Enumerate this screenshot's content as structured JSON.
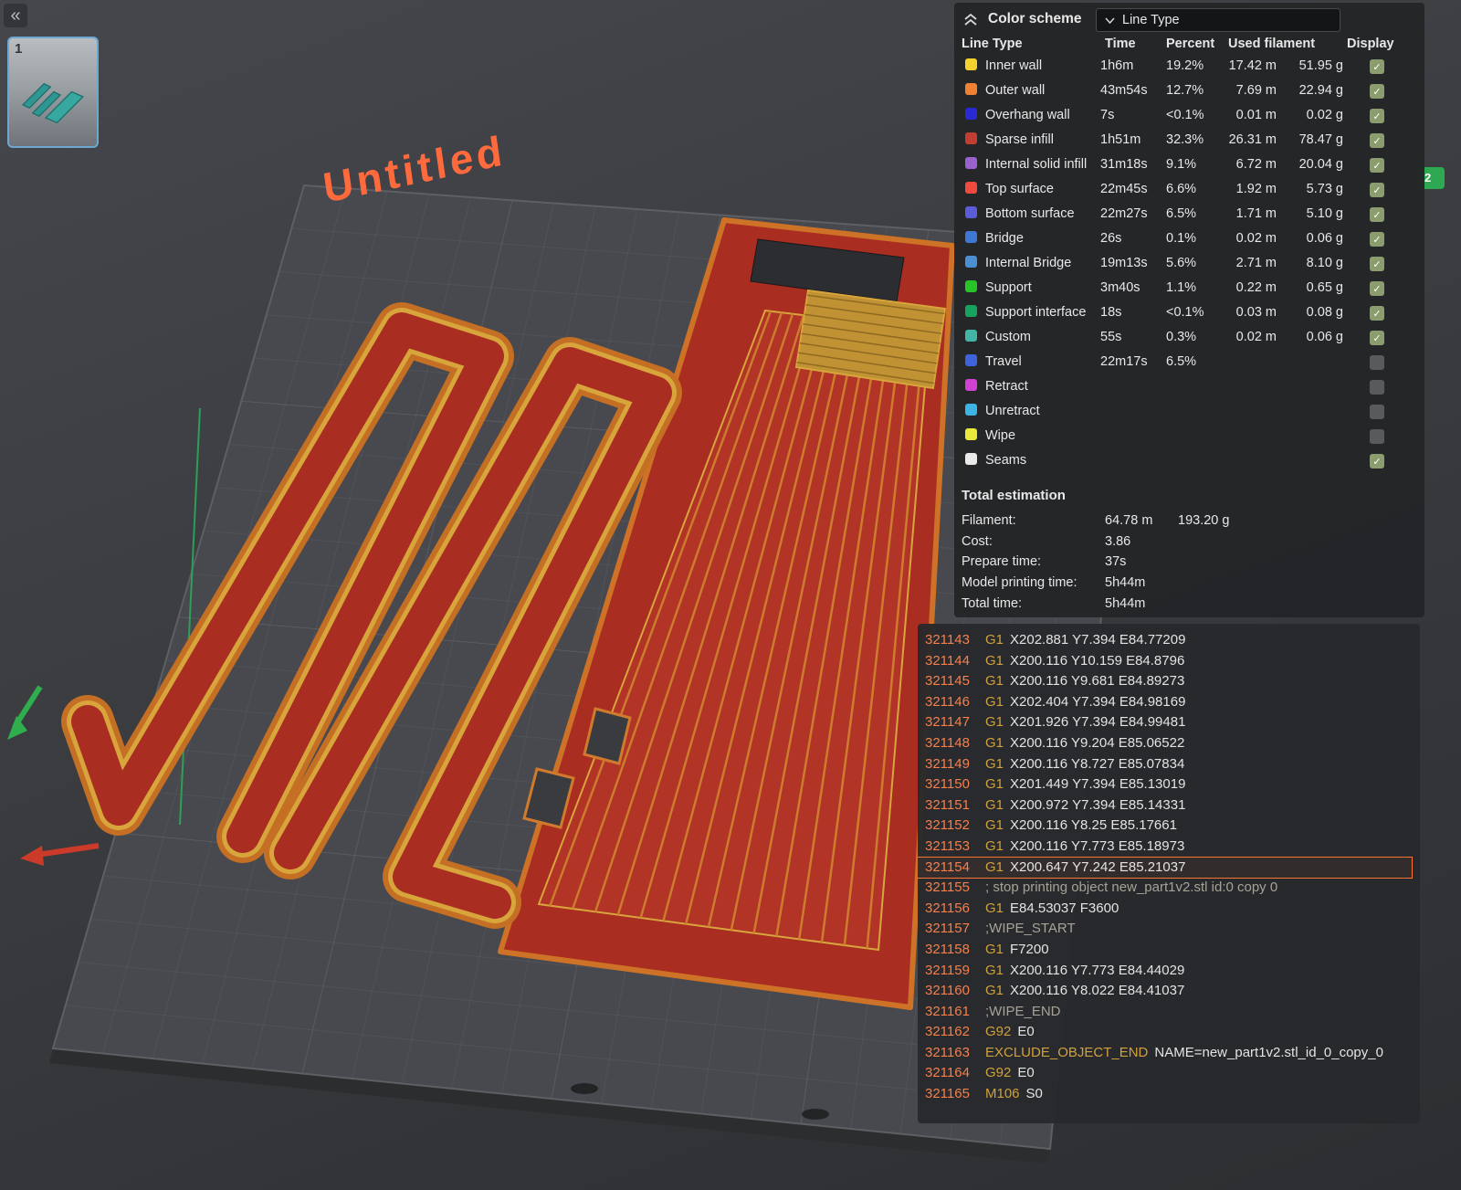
{
  "viewport": {
    "plate_label": "Untitled",
    "thumbnail_label": "1",
    "edge_badge": "2"
  },
  "icons": {
    "collapse_sidebar": "«",
    "check": "✓"
  },
  "color_scheme_panel": {
    "title": "Color scheme",
    "dropdown_value": "Line Type",
    "columns": [
      "Line Type",
      "Time",
      "Percent",
      "Used filament",
      "Display"
    ],
    "rows": [
      {
        "name": "Inner wall",
        "color": "#f6d32c",
        "time": "1h6m",
        "percent": "19.2%",
        "used_m": "17.42 m",
        "used_g": "51.95 g",
        "checked": true
      },
      {
        "name": "Outer wall",
        "color": "#f08132",
        "time": "43m54s",
        "percent": "12.7%",
        "used_m": "7.69 m",
        "used_g": "22.94 g",
        "checked": true
      },
      {
        "name": "Overhang wall",
        "color": "#2a2ad4",
        "time": "7s",
        "percent": "<0.1%",
        "used_m": "0.01 m",
        "used_g": "0.02 g",
        "checked": true
      },
      {
        "name": "Sparse infill",
        "color": "#c03e34",
        "time": "1h51m",
        "percent": "32.3%",
        "used_m": "26.31 m",
        "used_g": "78.47 g",
        "checked": true
      },
      {
        "name": "Internal solid infill",
        "color": "#9a62cc",
        "time": "31m18s",
        "percent": "9.1%",
        "used_m": "6.72 m",
        "used_g": "20.04 g",
        "checked": true
      },
      {
        "name": "Top surface",
        "color": "#f04a3e",
        "time": "22m45s",
        "percent": "6.6%",
        "used_m": "1.92 m",
        "used_g": "5.73 g",
        "checked": true
      },
      {
        "name": "Bottom surface",
        "color": "#5b5cd8",
        "time": "22m27s",
        "percent": "6.5%",
        "used_m": "1.71 m",
        "used_g": "5.10 g",
        "checked": true
      },
      {
        "name": "Bridge",
        "color": "#3f77d4",
        "time": "26s",
        "percent": "0.1%",
        "used_m": "0.02 m",
        "used_g": "0.06 g",
        "checked": true
      },
      {
        "name": "Internal Bridge",
        "color": "#4b8fd2",
        "time": "19m13s",
        "percent": "5.6%",
        "used_m": "2.71 m",
        "used_g": "8.10 g",
        "checked": true
      },
      {
        "name": "Support",
        "color": "#27c327",
        "time": "3m40s",
        "percent": "1.1%",
        "used_m": "0.22 m",
        "used_g": "0.65 g",
        "checked": true
      },
      {
        "name": "Support interface",
        "color": "#17a35f",
        "time": "18s",
        "percent": "<0.1%",
        "used_m": "0.03 m",
        "used_g": "0.08 g",
        "checked": true
      },
      {
        "name": "Custom",
        "color": "#43b5a6",
        "time": "55s",
        "percent": "0.3%",
        "used_m": "0.02 m",
        "used_g": "0.06 g",
        "checked": true
      },
      {
        "name": "Travel",
        "color": "#3e63dd",
        "time": "22m17s",
        "percent": "6.5%",
        "used_m": "",
        "used_g": "",
        "checked": false
      },
      {
        "name": "Retract",
        "color": "#d242d2",
        "time": "",
        "percent": "",
        "used_m": "",
        "used_g": "",
        "checked": false
      },
      {
        "name": "Unretract",
        "color": "#3eb4e4",
        "time": "",
        "percent": "",
        "used_m": "",
        "used_g": "",
        "checked": false
      },
      {
        "name": "Wipe",
        "color": "#e9e93c",
        "time": "",
        "percent": "",
        "used_m": "",
        "used_g": "",
        "checked": false
      },
      {
        "name": "Seams",
        "color": "#eaeaea",
        "time": "",
        "percent": "",
        "used_m": "",
        "used_g": "",
        "checked": true
      }
    ],
    "total_estimation": {
      "title": "Total estimation",
      "rows": [
        {
          "label": "Filament:",
          "v1": "64.78 m",
          "v2": "193.20 g"
        },
        {
          "label": "Cost:",
          "v1": "3.86",
          "v2": ""
        },
        {
          "label": "Prepare time:",
          "v1": "37s",
          "v2": ""
        },
        {
          "label": "Model printing time:",
          "v1": "5h44m",
          "v2": ""
        },
        {
          "label": "Total time:",
          "v1": "5h44m",
          "v2": ""
        }
      ]
    }
  },
  "gcode_panel": {
    "selected": "321154",
    "lines": [
      {
        "no": "321143",
        "cmd": "G1",
        "rest": "X202.881 Y7.394 E84.77209"
      },
      {
        "no": "321144",
        "cmd": "G1",
        "rest": "X200.116 Y10.159 E84.8796"
      },
      {
        "no": "321145",
        "cmd": "G1",
        "rest": "X200.116 Y9.681 E84.89273"
      },
      {
        "no": "321146",
        "cmd": "G1",
        "rest": "X202.404 Y7.394 E84.98169"
      },
      {
        "no": "321147",
        "cmd": "G1",
        "rest": "X201.926 Y7.394 E84.99481"
      },
      {
        "no": "321148",
        "cmd": "G1",
        "rest": "X200.116 Y9.204 E85.06522"
      },
      {
        "no": "321149",
        "cmd": "G1",
        "rest": "X200.116 Y8.727 E85.07834"
      },
      {
        "no": "321150",
        "cmd": "G1",
        "rest": "X201.449 Y7.394 E85.13019"
      },
      {
        "no": "321151",
        "cmd": "G1",
        "rest": "X200.972 Y7.394 E85.14331"
      },
      {
        "no": "321152",
        "cmd": "G1",
        "rest": "X200.116 Y8.25 E85.17661"
      },
      {
        "no": "321153",
        "cmd": "G1",
        "rest": "X200.116 Y7.773 E85.18973"
      },
      {
        "no": "321154",
        "cmd": "G1",
        "rest": "X200.647 Y7.242 E85.21037"
      },
      {
        "no": "321155",
        "comment": "; stop printing object new_part1v2.stl id:0 copy 0"
      },
      {
        "no": "321156",
        "cmd": "G1",
        "rest": "E84.53037 F3600"
      },
      {
        "no": "321157",
        "comment": ";WIPE_START"
      },
      {
        "no": "321158",
        "cmd": "G1",
        "rest": "F7200"
      },
      {
        "no": "321159",
        "cmd": "G1",
        "rest": "X200.116 Y7.773 E84.44029"
      },
      {
        "no": "321160",
        "cmd": "G1",
        "rest": "X200.116 Y8.022 E84.41037"
      },
      {
        "no": "321161",
        "comment": ";WIPE_END"
      },
      {
        "no": "321162",
        "cmd": "G92",
        "rest": "E0"
      },
      {
        "no": "321163",
        "cmd": "EXCLUDE_OBJECT_END",
        "rest": "NAME=new_part1v2.stl_id_0_copy_0"
      },
      {
        "no": "321164",
        "cmd": "G92",
        "rest": "E0"
      },
      {
        "no": "321165",
        "cmd": "M106",
        "rest": "S0"
      }
    ]
  }
}
